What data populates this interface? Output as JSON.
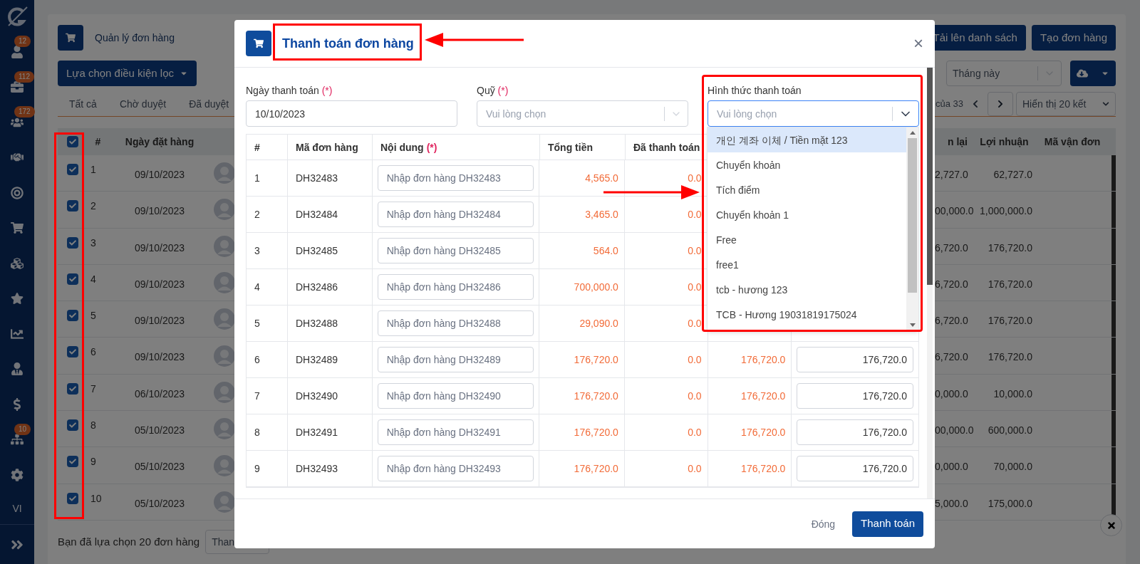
{
  "sidebar": {
    "items": [
      {
        "kind": "user",
        "badge": "12"
      },
      {
        "kind": "briefcase",
        "badge": "112"
      },
      {
        "kind": "group",
        "badge": "172"
      },
      {
        "kind": "handshake"
      },
      {
        "kind": "target"
      },
      {
        "kind": "cart"
      },
      {
        "kind": "cubes"
      },
      {
        "kind": "star"
      },
      {
        "kind": "chart"
      },
      {
        "kind": "person"
      },
      {
        "kind": "dollar"
      },
      {
        "kind": "sitemap",
        "badge": "10"
      },
      {
        "kind": "settings"
      }
    ],
    "language": "VI"
  },
  "page": {
    "title": "Quản lý đơn hàng",
    "upload_button": "Tải lên danh sách",
    "create_button": "Tạo đơn hàng",
    "filter_button": "Lựa chọn điều kiện lọc",
    "period_select": "Tháng này",
    "tabs": [
      {
        "label": "Tất cả"
      },
      {
        "label": "Chờ duyệt"
      },
      {
        "label": "Đã duyệt"
      }
    ],
    "pagination": {
      "range": "của 33",
      "page_size": "Hiển thị 20 kết"
    },
    "table": {
      "all_checked": true,
      "columns_left": [
        "#",
        "Ngày đặt hàng"
      ],
      "columns_right": [
        "n lại",
        "Lợi nhuận",
        "Mã vận đơn"
      ],
      "rows": [
        {
          "checked": true,
          "index": "1",
          "date": "09/10/2023",
          "column_right_1": "2,727.0",
          "profit": "62,727.0"
        },
        {
          "checked": true,
          "index": "2",
          "date": "09/10/2023",
          "column_right_1": "00,000.0",
          "profit": "1,000,000.0"
        },
        {
          "checked": true,
          "index": "3",
          "date": "09/10/2023",
          "column_right_1": "6,720.0",
          "profit": "176,720.0"
        },
        {
          "checked": true,
          "index": "4",
          "date": "09/10/2023",
          "column_right_1": "6,720.0",
          "profit": "176,720.0"
        },
        {
          "checked": true,
          "index": "5",
          "date": "09/10/2023",
          "column_right_1": "6,720.0",
          "profit": "176,720.0"
        },
        {
          "checked": true,
          "index": "6",
          "date": "09/10/2023",
          "column_right_1": "6,720.0",
          "profit": "176,720.0"
        },
        {
          "checked": true,
          "index": "7",
          "date": "06/10/2023",
          "column_right_1": "0,000.0",
          "profit": "10,000.0"
        },
        {
          "checked": true,
          "index": "8",
          "date": "05/10/2023",
          "column_right_1": "00,000.0",
          "profit": "600,000.0"
        },
        {
          "checked": true,
          "index": "9",
          "date": "05/10/2023",
          "column_right_1": "0,000.0",
          "profit": "70,000.0"
        },
        {
          "checked": true,
          "index": "10",
          "date": "05/10/2023",
          "column_right_1": "5,000.0",
          "profit": "175,000.0"
        }
      ]
    },
    "selection_summary": "Bạn đã lựa chọn 20 đơn hàng",
    "footer_select": "Than"
  },
  "modal": {
    "title": "Thanh toán đơn hàng",
    "close": "×",
    "fields": [
      {
        "kind": "text",
        "label": "Ngày thanh toán",
        "required_mark": "(*)",
        "value": "10/10/2023",
        "focused": false
      },
      {
        "kind": "select",
        "label": "Quỹ",
        "required_mark": "(*)",
        "placeholder": "Vui lòng chọn",
        "focused": false
      },
      {
        "kind": "select",
        "label": "Hình thức thanh toán",
        "placeholder": "Vui lòng chọn",
        "focused": true,
        "expanded": true,
        "options": [
          {
            "label": "개인 계좌 이체 / Tiền mặt 123",
            "highlighted": true
          },
          {
            "label": "Chuyển khoản",
            "highlighted": false
          },
          {
            "label": "Tích điểm",
            "highlighted": false
          },
          {
            "label": "Chuyển khoản 1",
            "highlighted": false
          },
          {
            "label": "Free",
            "highlighted": false
          },
          {
            "label": "free1",
            "highlighted": false
          },
          {
            "label": "tcb - hương 123",
            "highlighted": false
          },
          {
            "label": "TCB - Hương 19031819175024",
            "highlighted": false
          }
        ]
      }
    ],
    "table": {
      "columns": [
        {
          "label": "#"
        },
        {
          "label": "Mã đơn hàng"
        },
        {
          "label": "Nội dung",
          "required_mark": "(*)"
        },
        {
          "label": "Tổng tiền"
        },
        {
          "label": "Đã thanh toán"
        }
      ],
      "rows": [
        {
          "index": "1",
          "code": "DH32483",
          "content_placeholder": "Nhập đơn hàng DH32483",
          "total": "4,565.0",
          "paid": "0.0"
        },
        {
          "index": "2",
          "code": "DH32484",
          "content_placeholder": "Nhập đơn hàng DH32484",
          "total": "3,465.0",
          "paid": "0.0"
        },
        {
          "index": "3",
          "code": "DH32485",
          "content_placeholder": "Nhập đơn hàng DH32485",
          "total": "564.0",
          "paid": "0.0"
        },
        {
          "index": "4",
          "code": "DH32486",
          "content_placeholder": "Nhập đơn hàng DH32486",
          "total": "700,000.0",
          "paid": "0.0"
        },
        {
          "index": "5",
          "code": "DH32488",
          "content_placeholder": "Nhập đơn hàng DH32488",
          "total": "29,090.0",
          "paid": "0.0"
        },
        {
          "index": "6",
          "code": "DH32489",
          "content_placeholder": "Nhập đơn hàng DH32489",
          "total": "176,720.0",
          "paid": "0.0",
          "remaining": "176,720.0",
          "amount": "176,720.0"
        },
        {
          "index": "7",
          "code": "DH32490",
          "content_placeholder": "Nhập đơn hàng DH32490",
          "total": "176,720.0",
          "paid": "0.0",
          "remaining": "176,720.0",
          "amount": "176,720.0"
        },
        {
          "index": "8",
          "code": "DH32491",
          "content_placeholder": "Nhập đơn hàng DH32491",
          "total": "176,720.0",
          "paid": "0.0",
          "remaining": "176,720.0",
          "amount": "176,720.0"
        },
        {
          "index": "9",
          "code": "DH32493",
          "content_placeholder": "Nhập đơn hàng DH32493",
          "total": "176,720.0",
          "paid": "0.0",
          "remaining": "176,720.0",
          "amount": "176,720.0"
        }
      ]
    },
    "cancel_button": "Đóng",
    "submit_button": "Thanh toán"
  }
}
